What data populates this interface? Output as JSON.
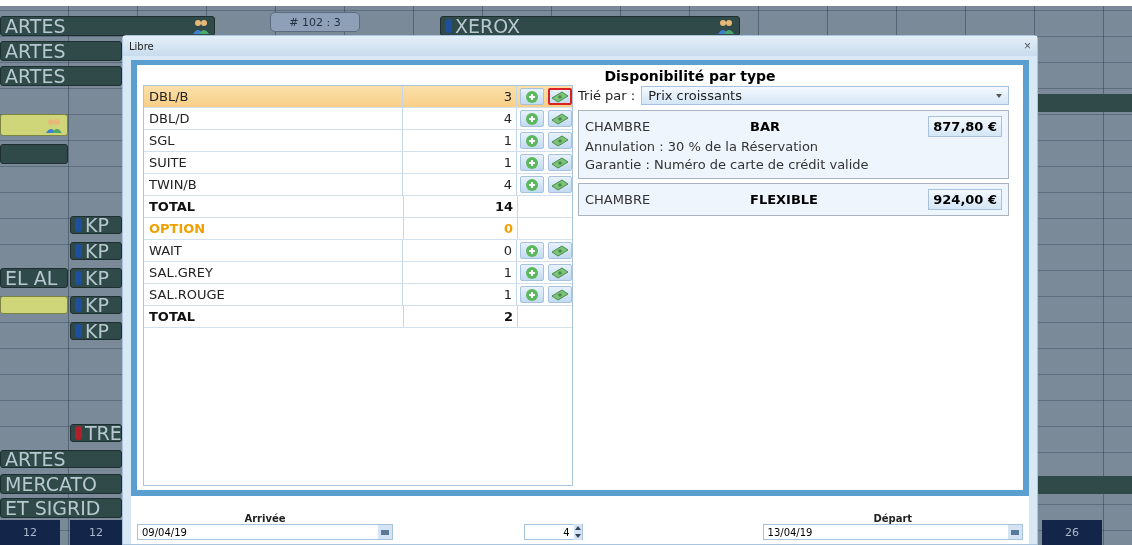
{
  "planning": {
    "bookings": [
      {
        "label": "ARTES",
        "kind": "bar",
        "people": true
      },
      {
        "label": "# 102 : 3",
        "kind": "badge",
        "people": false
      },
      {
        "label": "XEROX",
        "kind": "bar",
        "people": true,
        "color": "#1d4f9c"
      },
      {
        "label": "ARTES",
        "kind": "bar",
        "people": false
      },
      {
        "label": "ARTES",
        "kind": "bar",
        "people": false
      },
      {
        "kind": "yellow",
        "people": true
      },
      {
        "kind": "bar",
        "people": false
      },
      {
        "label": "KP",
        "kind": "bar",
        "people": false,
        "color": "#1d4f9c"
      },
      {
        "label": "KP",
        "kind": "bar",
        "people": false,
        "color": "#1d4f9c"
      },
      {
        "label": "EL AL",
        "kind": "bar",
        "people": false
      },
      {
        "label": "KP",
        "kind": "bar",
        "people": false,
        "color": "#1d4f9c"
      },
      {
        "kind": "yellow",
        "people": false
      },
      {
        "label": "KP",
        "kind": "bar",
        "people": false,
        "color": "#1d4f9c"
      },
      {
        "label": "KP",
        "kind": "bar",
        "people": false,
        "color": "#1d4f9c"
      },
      {
        "label": "TRE",
        "kind": "bar",
        "people": false,
        "color": "#b0202a"
      },
      {
        "label": "ARTES",
        "kind": "bar",
        "people": false
      },
      {
        "label": "MERCATO",
        "kind": "bar",
        "people": false
      },
      {
        "label": "ET SIGRID",
        "kind": "bar",
        "people": false
      }
    ],
    "days": [
      "12",
      "12",
      "26"
    ]
  },
  "dialog": {
    "title": "Libre",
    "close": "×",
    "heading": "Disponibilité par type",
    "rows": [
      {
        "kind": "room",
        "name": "DBL/B",
        "count": "3",
        "selected": true,
        "rate_highlighted": true
      },
      {
        "kind": "room",
        "name": "DBL/D",
        "count": "4",
        "selected": false,
        "rate_highlighted": false
      },
      {
        "kind": "room",
        "name": "SGL",
        "count": "1",
        "selected": false,
        "rate_highlighted": false
      },
      {
        "kind": "room",
        "name": "SUITE",
        "count": "1",
        "selected": false,
        "rate_highlighted": false
      },
      {
        "kind": "room",
        "name": "TWIN/B",
        "count": "4",
        "selected": false,
        "rate_highlighted": false
      },
      {
        "kind": "total",
        "name": "TOTAL",
        "count": "14",
        "selected": false
      },
      {
        "kind": "option",
        "name": "OPTION",
        "count": "0",
        "selected": false
      },
      {
        "kind": "room",
        "name": "WAIT",
        "count": "0",
        "selected": false,
        "rate_highlighted": false
      },
      {
        "kind": "room",
        "name": "SAL.GREY",
        "count": "1",
        "selected": false,
        "rate_highlighted": false
      },
      {
        "kind": "room",
        "name": "SAL.ROUGE",
        "count": "1",
        "selected": false,
        "rate_highlighted": false
      },
      {
        "kind": "total",
        "name": "TOTAL",
        "count": "2",
        "selected": false
      }
    ],
    "sort": {
      "label": "Trié par :",
      "value": "Prix croissants"
    },
    "rates": [
      {
        "room": "CHAMBRE",
        "name": "BAR",
        "price": "877,80 €",
        "lines": [
          "Annulation : 30 % de la Réservation",
          "Garantie : Numéro de carte de crédit valide"
        ]
      },
      {
        "room": "CHAMBRE",
        "name": "FLEXIBLE",
        "price": "924,00 €"
      }
    ],
    "arrival": {
      "label": "Arrivée",
      "value": "09/04/19"
    },
    "nights": {
      "value": "4"
    },
    "departure": {
      "label": "Départ",
      "value": "13/04/19"
    }
  }
}
